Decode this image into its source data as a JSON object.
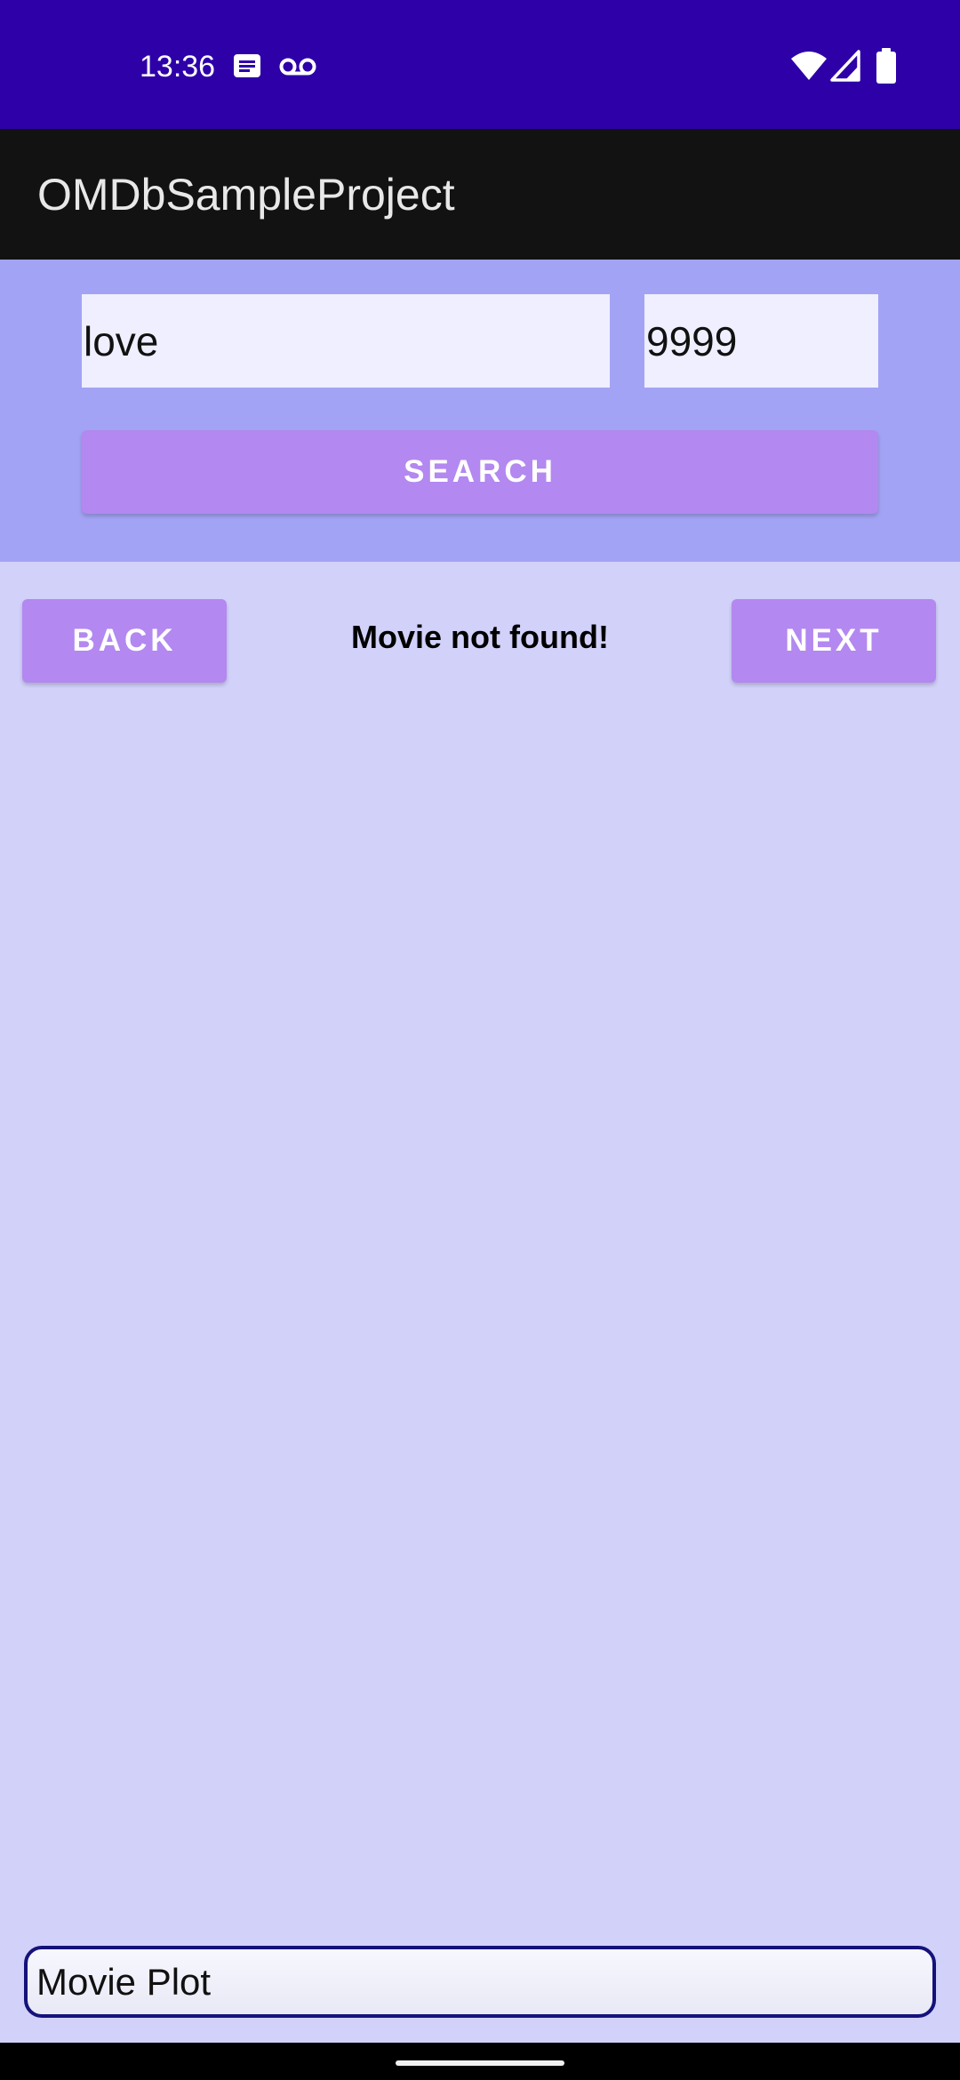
{
  "status_bar": {
    "time": "13:36",
    "icons": [
      "message-notification-icon",
      "voicemail-icon",
      "wifi-icon",
      "cell-signal-icon",
      "battery-icon"
    ]
  },
  "app_bar": {
    "title": "OMDbSampleProject"
  },
  "search": {
    "query_value": "love",
    "year_value": "9999",
    "button_label": "SEARCH"
  },
  "results": {
    "back_label": "BACK",
    "next_label": "NEXT",
    "message": "Movie not found!"
  },
  "plot": {
    "placeholder": "Movie Plot"
  },
  "colors": {
    "status_bar": "#2e00a8",
    "app_bar": "#121212",
    "search_panel": "#a3a3f5",
    "content_background": "#d2d1fa",
    "button": "#b388f0",
    "input": "#efefff"
  }
}
